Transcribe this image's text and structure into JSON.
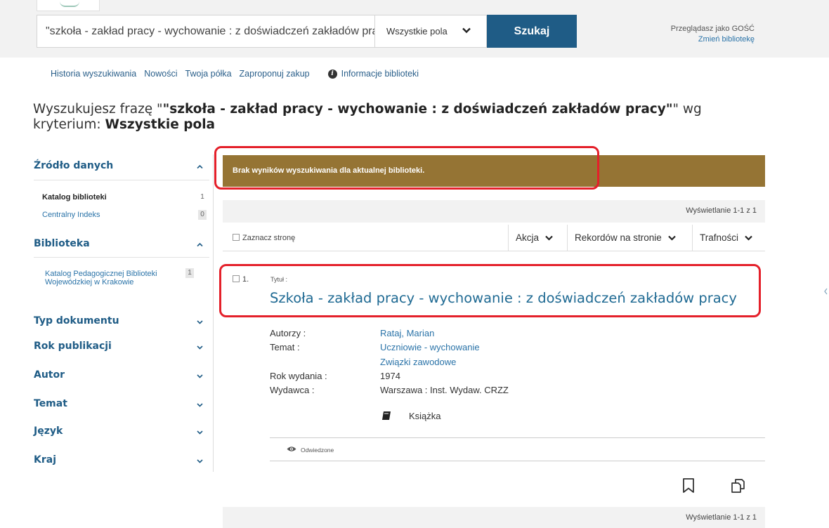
{
  "header": {
    "search_value": "\"szkoła - zakład pracy - wychowanie : z doświadczeń zakładów pracy\"",
    "search_scope": "Wszystkie pola",
    "search_button": "Szukaj",
    "guest_text": "Przeglądasz jako GOŚĆ",
    "change_library": "Zmień bibliotekę"
  },
  "nav": {
    "items": [
      "Historia wyszukiwania",
      "Nowości",
      "Twoja półka",
      "Zaproponuj zakup"
    ],
    "info": "Informacje biblioteki"
  },
  "heading": {
    "prefix": "Wyszukujesz frazę \"",
    "phrase": "\"szkoła - zakład pracy - wychowanie : z doświadczeń zakładów pracy\"",
    "middle": "\" wg kryterium: ",
    "criterion": "Wszystkie pola"
  },
  "sidebar": {
    "facets": [
      {
        "title": "Źródło danych",
        "expanded": true,
        "items": [
          {
            "label": "Katalog biblioteki",
            "count": "1"
          },
          {
            "label": "Centralny Indeks",
            "count": "0"
          }
        ]
      },
      {
        "title": "Biblioteka",
        "expanded": true,
        "items": [
          {
            "label": "Katalog Pedagogicznej Biblioteki",
            "label2": "Wojewódzkiej w Krakowie",
            "count": "1"
          }
        ]
      },
      {
        "title": "Typ dokumentu",
        "expanded": false
      },
      {
        "title": "Rok publikacji",
        "expanded": false
      },
      {
        "title": "Autor",
        "expanded": false
      },
      {
        "title": "Temat",
        "expanded": false
      },
      {
        "title": "Język",
        "expanded": false
      },
      {
        "title": "Kraj",
        "expanded": false
      }
    ]
  },
  "results": {
    "no_results_message": "Brak wyników wyszukiwania dla aktualnej biblioteki.",
    "count_text": "Wyświetlanie 1-1 z 1",
    "select_page": "Zaznacz stronę",
    "action": "Akcja",
    "records_per_page": "Rekordów na stronie",
    "sort": "Trafności",
    "record": {
      "number": "1.",
      "title_label": "Tytuł :",
      "title": "Szkoła - zakład pracy - wychowanie : z doświadczeń zakładów pracy",
      "authors_label": "Autorzy :",
      "authors": "Rataj, Marian",
      "subject_label": "Temat :",
      "subjects": [
        "Uczniowie - wychowanie",
        "Związki zawodowe"
      ],
      "year_label": "Rok wydania :",
      "year": "1974",
      "publisher_label": "Wydawca :",
      "publisher": "Warszawa : Inst. Wydaw. CRZZ",
      "format": "Książka",
      "visited": "Odwiedzone"
    }
  },
  "colors": {
    "primary": "#1f5c86",
    "link": "#2a73a8",
    "alert_bg": "#957434",
    "highlight": "#e4202a"
  }
}
